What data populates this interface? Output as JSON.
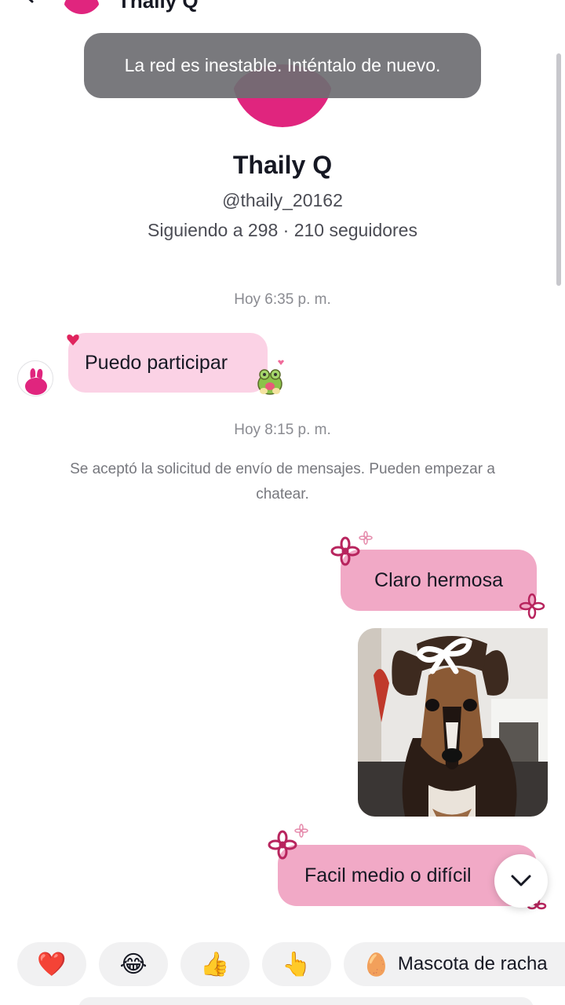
{
  "header": {
    "name": "Thaily Q"
  },
  "toast": {
    "text": "La red es inestable. Inténtalo de nuevo."
  },
  "profile": {
    "name": "Thaily Q",
    "handle": "@thaily_20162",
    "stats": "Siguiendo a 298 · 210 seguidores"
  },
  "timestamps": [
    "Hoy 6:35 p. m.",
    "Hoy 8:15 p. m."
  ],
  "system_message": "Se aceptó la solicitud de envío de mensajes. Pueden empezar a chatear.",
  "messages": {
    "incoming_1": "Puedo participar",
    "outgoing_1": "Claro hermosa",
    "outgoing_2": "Facil medio o difícil"
  },
  "quick_replies": {
    "heart": "❤️",
    "laugh": "😂",
    "thumbs": "👍",
    "point": "👆",
    "streak_icon": "🥚",
    "streak_label": "Mascota de racha"
  },
  "colors": {
    "incoming_bubble": "#fbd2e5",
    "outgoing_bubble": "#f1a9c6",
    "avatar_pink": "#e0257e",
    "flower": "#b8255e"
  }
}
